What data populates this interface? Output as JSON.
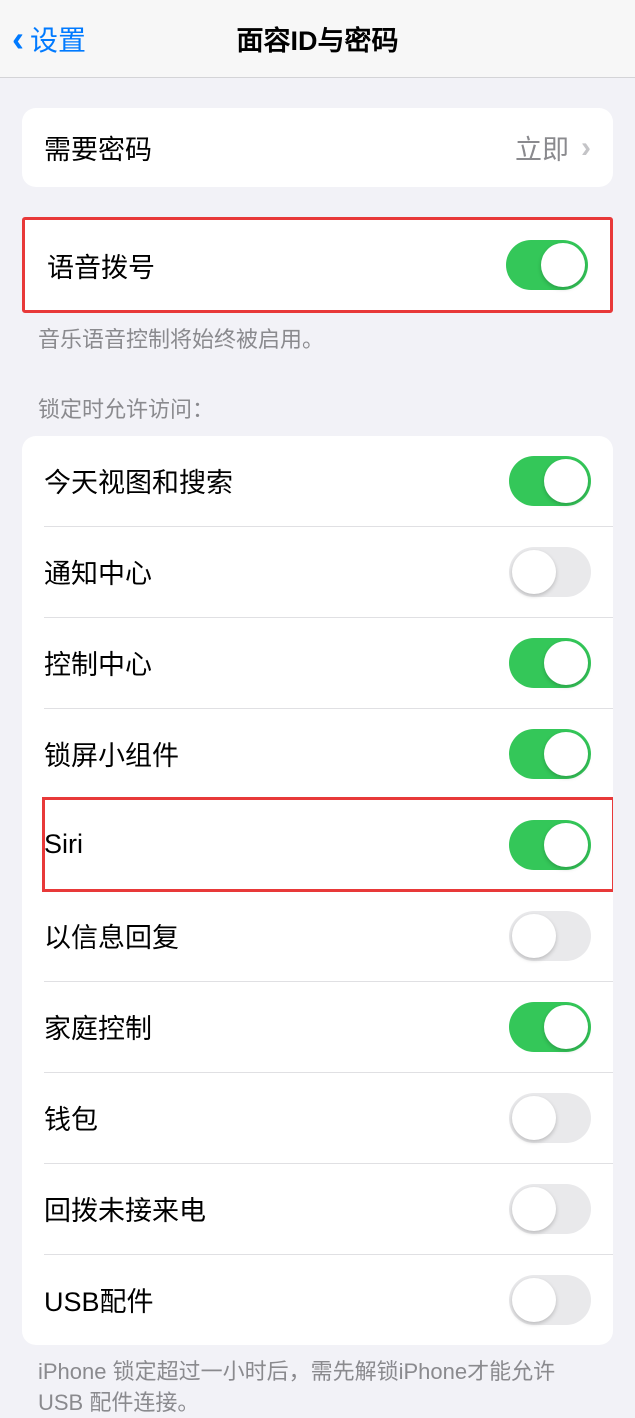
{
  "header": {
    "back_label": "设置",
    "title": "面容ID与密码"
  },
  "require_passcode": {
    "label": "需要密码",
    "value": "立即"
  },
  "voice_dial": {
    "label": "语音拨号",
    "state": "on",
    "footer": "音乐语音控制将始终被启用。"
  },
  "locked_access": {
    "section_header": "锁定时允许访问：",
    "items": [
      {
        "label": "今天视图和搜索",
        "state": "on"
      },
      {
        "label": "通知中心",
        "state": "off"
      },
      {
        "label": "控制中心",
        "state": "on"
      },
      {
        "label": "锁屏小组件",
        "state": "on"
      },
      {
        "label": "Siri",
        "state": "on"
      },
      {
        "label": "以信息回复",
        "state": "off"
      },
      {
        "label": "家庭控制",
        "state": "on"
      },
      {
        "label": "钱包",
        "state": "off"
      },
      {
        "label": "回拨未接来电",
        "state": "off"
      },
      {
        "label": "USB配件",
        "state": "off"
      }
    ],
    "footer": "iPhone 锁定超过一小时后，需先解锁iPhone才能允许USB 配件连接。"
  }
}
